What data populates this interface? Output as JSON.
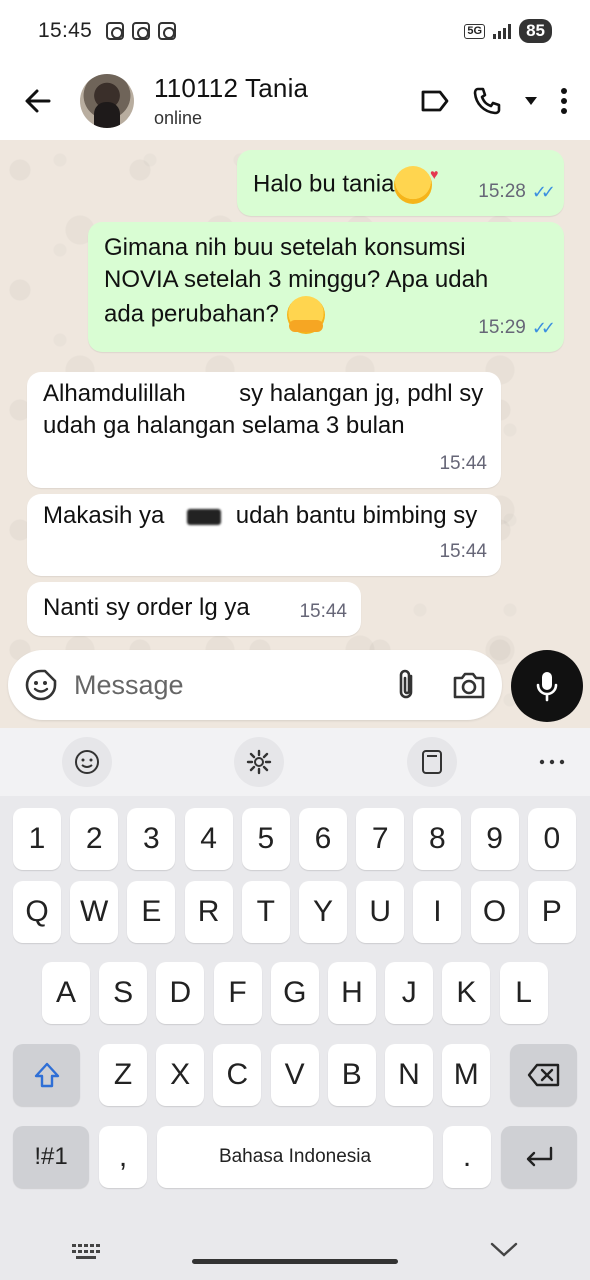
{
  "status_bar": {
    "time": "15:45",
    "network": "5G",
    "battery": "85"
  },
  "header": {
    "contact_name": "110112 Tania",
    "contact_status": "online"
  },
  "messages": [
    {
      "direction": "out",
      "text": "Halo bu tania",
      "emoji": "smiling-face-with-hearts",
      "time": "15:28",
      "read": true
    },
    {
      "direction": "out",
      "text": "Gimana nih buu setelah konsumsi NOVIA setelah 3 minggu? Apa udah ada perubahan?",
      "emoji": "hugging-face",
      "time": "15:29",
      "read": true
    },
    {
      "direction": "in",
      "text_a": "Alhamdulillah",
      "text_b": "sy halangan jg, pdhl sy udah ga halangan selama 3 bulan",
      "time": "15:44"
    },
    {
      "direction": "in",
      "text_a": "Makasih ya",
      "text_b": "udah bantu bimbing sy",
      "time": "15:44"
    },
    {
      "direction": "in",
      "text": "Nanti sy order lg ya",
      "time": "15:44"
    }
  ],
  "composer": {
    "placeholder": "Message"
  },
  "keyboard": {
    "row_numbers": [
      "1",
      "2",
      "3",
      "4",
      "5",
      "6",
      "7",
      "8",
      "9",
      "0"
    ],
    "row_top": [
      "Q",
      "W",
      "E",
      "R",
      "T",
      "Y",
      "U",
      "I",
      "O",
      "P"
    ],
    "row_mid": [
      "A",
      "S",
      "D",
      "F",
      "G",
      "H",
      "J",
      "K",
      "L"
    ],
    "row_bottom": [
      "Z",
      "X",
      "C",
      "V",
      "B",
      "N",
      "M"
    ],
    "symbols_key": "!#1",
    "comma_key": ",",
    "space_label": "Bahasa Indonesia",
    "period_key": "."
  },
  "colors": {
    "outgoing_bubble": "#d9fdd3",
    "incoming_bubble": "#ffffff",
    "chat_bg": "#efe7de",
    "read_ticks": "#3b8fe0"
  }
}
